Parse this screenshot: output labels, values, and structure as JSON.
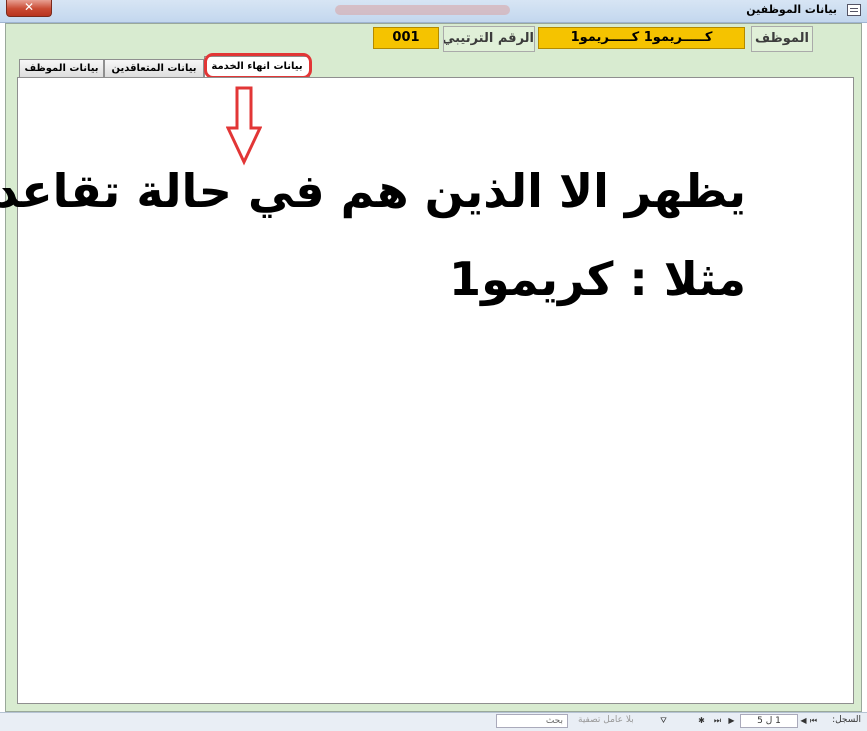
{
  "window": {
    "title": "بيانات الموظفين",
    "close_glyph": "✕"
  },
  "header": {
    "employee_label": "الموظف",
    "employee_value": "كـــــريمو1 كـــــريمو1",
    "serial_label": "الرقم الترتيبي",
    "serial_value": "001"
  },
  "tabs": [
    {
      "label": "بيانات الموظف"
    },
    {
      "label": "بيانات المتعاقدين"
    },
    {
      "label": "بيانات انهاء الخدمة"
    }
  ],
  "annotation": {
    "line1": "يظهر الا الذين هم في حالة تقاعد",
    "line2": "مثلا : كريمو1",
    "color": "#e23636"
  },
  "navbar": {
    "record_label": "السجل:",
    "record_value": "1 ل 5",
    "filter_label": "بلا عامل تصفية",
    "search_placeholder": "بحث"
  },
  "colors": {
    "form_bg": "#d8ebd0",
    "field_accent": "#f5c300",
    "highlight": "#e23636"
  }
}
